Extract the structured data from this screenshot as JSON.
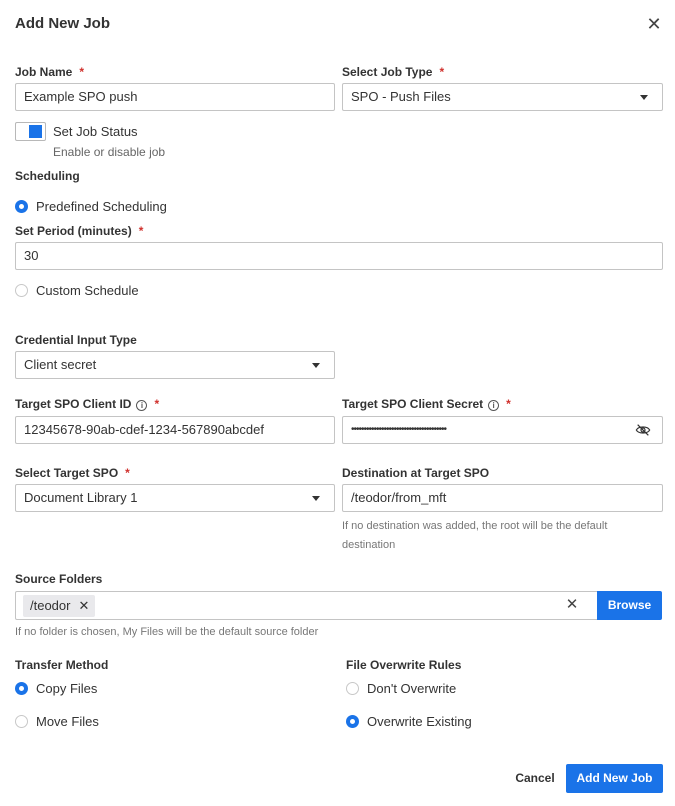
{
  "dialog": {
    "title": "Add New Job",
    "close_icon": "close-icon"
  },
  "job_name": {
    "label": "Job Name",
    "required_mark": "*",
    "value": "Example SPO push"
  },
  "job_type": {
    "label": "Select Job Type",
    "required_mark": "*",
    "value": "SPO - Push Files"
  },
  "job_status": {
    "label": "Set Job Status",
    "helper": "Enable or disable job",
    "enabled": true
  },
  "scheduling": {
    "label": "Scheduling",
    "predefined_label": "Predefined Scheduling",
    "period_label": "Set Period (minutes)",
    "required_mark": "*",
    "period_value": "30",
    "custom_label": "Custom Schedule",
    "selected": "predefined"
  },
  "credential": {
    "label": "Credential Input Type",
    "value": "Client secret"
  },
  "client_id": {
    "label": "Target SPO Client ID",
    "info": "i",
    "required_mark": "*",
    "value": "12345678-90ab-cdef-1234-567890abcdef"
  },
  "client_secret": {
    "label": "Target SPO Client Secret",
    "info": "i",
    "required_mark": "*",
    "masked_value": "••••••••••••••••••••••••••••••••••••••",
    "visibility_icon": "eye-off-icon"
  },
  "target_spo": {
    "label": "Select Target SPO",
    "required_mark": "*",
    "value": "Document Library 1"
  },
  "destination": {
    "label": "Destination at Target SPO",
    "value": "/teodor/from_mft",
    "helper_line1": "If no destination was added, the root will be the default",
    "helper_line2": "destination"
  },
  "source_folders": {
    "label": "Source Folders",
    "chip": "/teodor",
    "chip_remove": "✕",
    "clear": "✕",
    "browse_label": "Browse",
    "helper": "If no folder is chosen, My Files will be the default source folder"
  },
  "transfer_method": {
    "label": "Transfer Method",
    "options": [
      "Copy Files",
      "Move Files"
    ],
    "selected": "Copy Files"
  },
  "overwrite_rules": {
    "label": "File Overwrite Rules",
    "options": [
      "Don't Overwrite",
      "Overwrite Existing"
    ],
    "selected": "Overwrite Existing"
  },
  "footer": {
    "cancel_label": "Cancel",
    "submit_label": "Add New Job"
  },
  "colors": {
    "accent": "#1a73e8",
    "required": "#d0312d"
  }
}
